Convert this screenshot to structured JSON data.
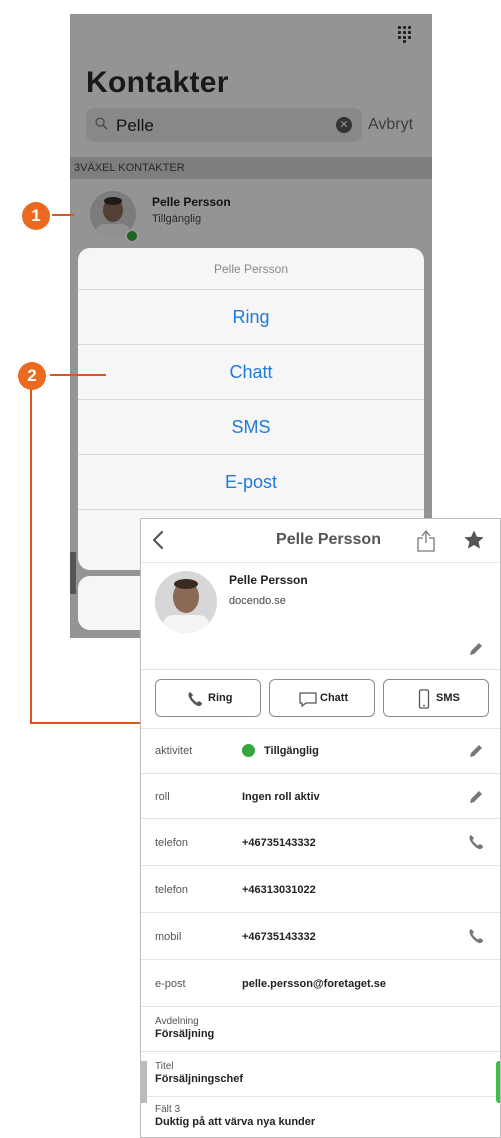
{
  "background_screen": {
    "title": "Kontakter",
    "search": {
      "value": "Pelle",
      "cancel_label": "Avbryt"
    },
    "section_header": "3VÄXEL KONTAKTER",
    "contact": {
      "name": "Pelle Persson",
      "status": "Tillgänglig"
    },
    "action_sheet": {
      "title": "Pelle Persson",
      "actions": [
        "Ring",
        "Chatt",
        "SMS",
        "E-post"
      ]
    }
  },
  "callouts": [
    "1",
    "2"
  ],
  "detail": {
    "nav_title": "Pelle Persson",
    "profile": {
      "name": "Pelle Persson",
      "organization": "docendo.se"
    },
    "action_buttons": {
      "ring": "Ring",
      "chatt": "Chatt",
      "sms": "SMS"
    },
    "fields": [
      {
        "key": "aktivitet",
        "value": "Tillgänglig"
      },
      {
        "key": "roll",
        "value": "Ingen roll aktiv"
      },
      {
        "key": "telefon",
        "value": "+46735143332"
      },
      {
        "key": "telefon",
        "value": "+46313031022"
      },
      {
        "key": "mobil",
        "value": "+46735143332"
      },
      {
        "key": "e-post",
        "value": "pelle.persson@foretaget.se"
      }
    ],
    "stacked_fields": [
      {
        "key": "Avdelning",
        "value": "Försäljning"
      },
      {
        "key": "Titel",
        "value": "Försäljningschef"
      },
      {
        "key": "Fält 3",
        "value": "Duktig på att värva nya kunder"
      }
    ]
  },
  "colors": {
    "accent_blue": "#1e7bd9",
    "callout_orange": "#ec6a1f",
    "status_green": "#35a63c"
  },
  "icons": [
    "dialpad-icon",
    "search-icon",
    "clear-icon",
    "back-chevron-icon",
    "share-icon",
    "star-icon",
    "pencil-icon",
    "phone-icon",
    "chat-bubble-icon",
    "mobile-phone-icon"
  ]
}
